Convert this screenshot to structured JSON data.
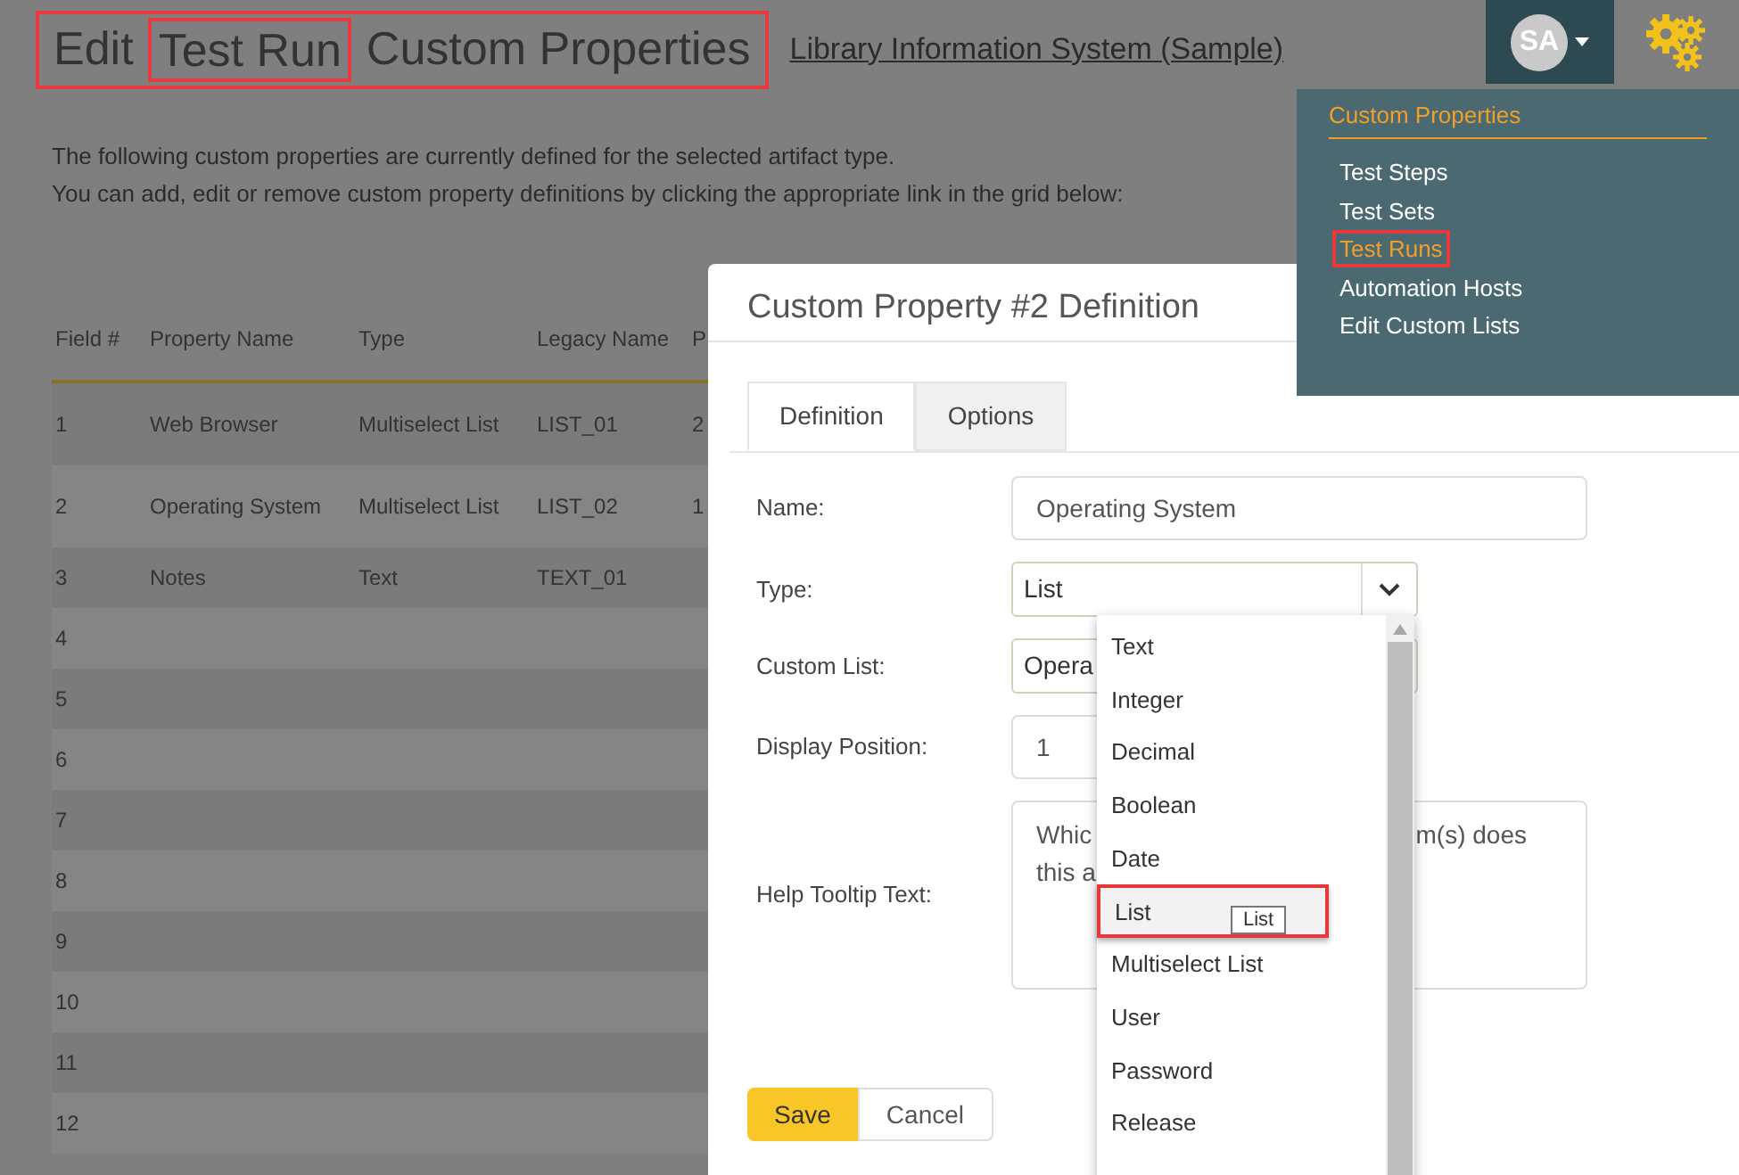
{
  "header": {
    "title": {
      "prefix": "Edit",
      "highlighted": "Test Run",
      "suffix": "Custom Properties"
    },
    "project_link": "Library Information System (Sample)",
    "avatar": "SA"
  },
  "intro": [
    "The following custom properties are currently defined for the selected artifact type.",
    "You can add, edit or remove custom property definitions by clicking the appropriate link in the grid below:"
  ],
  "table": {
    "columns": [
      "Field #",
      "Property Name",
      "Type",
      "Legacy Name",
      "P"
    ],
    "rows": [
      {
        "cells": [
          "1",
          "Web Browser",
          "Multiselect List",
          "LIST_01",
          "2"
        ]
      },
      {
        "cells": [
          "2",
          "Operating System",
          "Multiselect List",
          "LIST_02",
          "1"
        ]
      },
      {
        "cells": [
          "3",
          "Notes",
          "Text",
          "TEXT_01",
          ""
        ]
      },
      {
        "cells": [
          "4",
          "",
          "",
          "",
          ""
        ]
      },
      {
        "cells": [
          "5",
          "",
          "",
          "",
          ""
        ]
      },
      {
        "cells": [
          "6",
          "",
          "",
          "",
          ""
        ]
      },
      {
        "cells": [
          "7",
          "",
          "",
          "",
          ""
        ]
      },
      {
        "cells": [
          "8",
          "",
          "",
          "",
          ""
        ]
      },
      {
        "cells": [
          "9",
          "",
          "",
          "",
          ""
        ]
      },
      {
        "cells": [
          "10",
          "",
          "",
          "",
          ""
        ]
      },
      {
        "cells": [
          "11",
          "",
          "",
          "",
          ""
        ]
      },
      {
        "cells": [
          "12",
          "",
          "",
          "",
          ""
        ]
      }
    ]
  },
  "menu": {
    "title": "Custom Properties",
    "items": [
      {
        "label": "Test Steps",
        "selected": false
      },
      {
        "label": "Test Sets",
        "selected": false
      },
      {
        "label": "Test Runs",
        "selected": true
      },
      {
        "label": "Automation Hosts",
        "selected": false
      },
      {
        "label": "Edit Custom Lists",
        "selected": false
      }
    ]
  },
  "dialog": {
    "title": "Custom Property #2 Definition",
    "tabs": [
      {
        "label": "Definition",
        "selected": true
      },
      {
        "label": "Options",
        "selected": false
      }
    ],
    "fields": [
      {
        "kind": "input",
        "label": "Name:",
        "value": "Operating System"
      },
      {
        "kind": "select",
        "label": "Type:",
        "value": "List"
      },
      {
        "kind": "select",
        "label": "Custom List:",
        "value": "Opera"
      },
      {
        "kind": "short",
        "label": "Display Position:",
        "value": "1"
      },
      {
        "kind": "textarea",
        "label": "Help Tooltip Text:",
        "value_left": [
          "Whic",
          "this a"
        ],
        "value_right": "m(s) does"
      }
    ],
    "buttons": [
      {
        "label": "Save",
        "kind": "primary"
      },
      {
        "label": "Cancel",
        "kind": "default"
      }
    ],
    "dropdown": {
      "items": [
        {
          "label": "Text",
          "selected": false
        },
        {
          "label": "Integer",
          "selected": false
        },
        {
          "label": "Decimal",
          "selected": false
        },
        {
          "label": "Boolean",
          "selected": false
        },
        {
          "label": "Date",
          "selected": false
        },
        {
          "label": "List",
          "selected": true
        },
        {
          "label": "Multiselect List",
          "selected": false
        },
        {
          "label": "User",
          "selected": false
        },
        {
          "label": "Password",
          "selected": false
        },
        {
          "label": "Release",
          "selected": false
        }
      ],
      "tooltip": "List"
    }
  }
}
